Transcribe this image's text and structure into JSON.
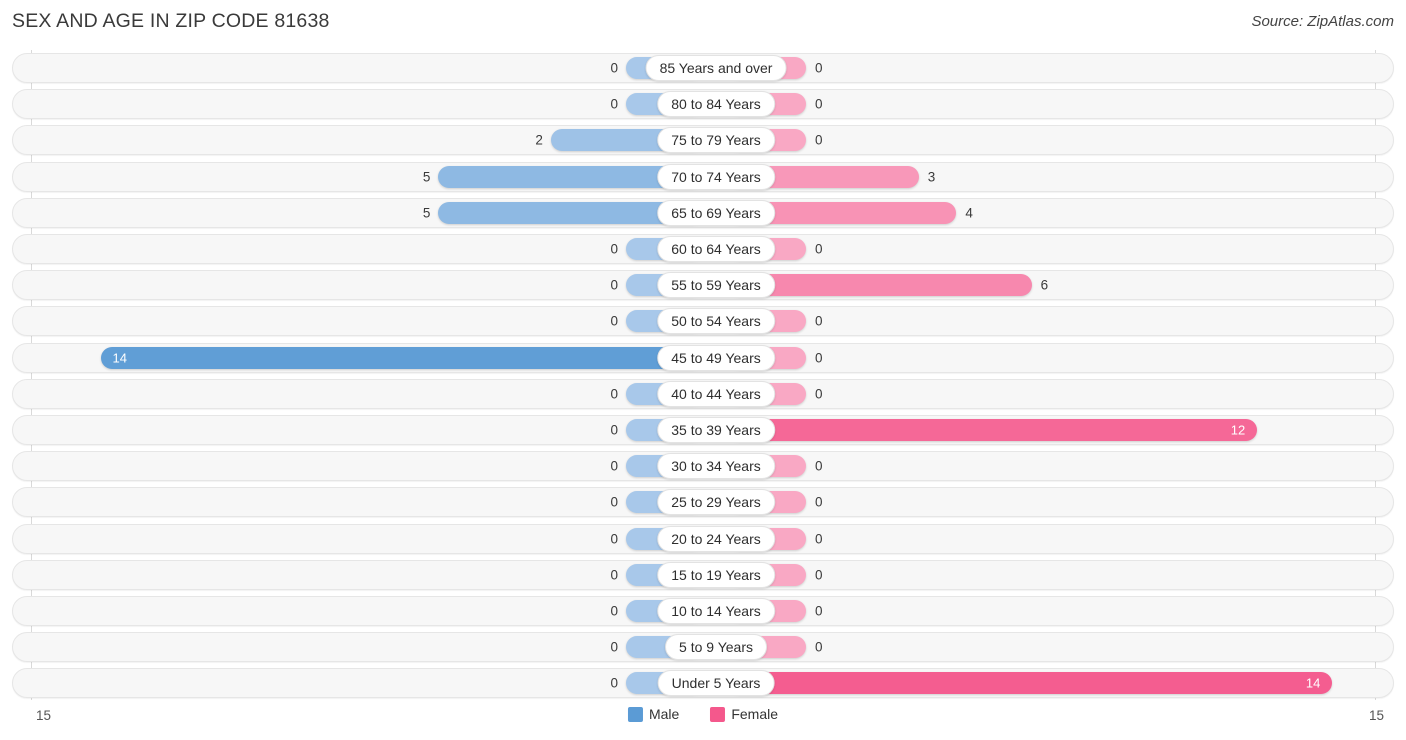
{
  "header": {
    "title": "SEX AND AGE IN ZIP CODE 81638",
    "source": "Source: ZipAtlas.com"
  },
  "legend": {
    "male_label": "Male",
    "female_label": "Female",
    "male_color": "#5b9bd5",
    "female_color": "#f4588c"
  },
  "axis": {
    "left_max": "15",
    "right_max": "15",
    "max_value": 15
  },
  "chart_data": {
    "type": "bar",
    "subtype": "population-pyramid",
    "title": "SEX AND AGE IN ZIP CODE 81638",
    "xlabel": "",
    "ylabel": "",
    "xlim": [
      15,
      15
    ],
    "grid": false,
    "legend_position": "bottom-center",
    "categories": [
      "85 Years and over",
      "80 to 84 Years",
      "75 to 79 Years",
      "70 to 74 Years",
      "65 to 69 Years",
      "60 to 64 Years",
      "55 to 59 Years",
      "50 to 54 Years",
      "45 to 49 Years",
      "40 to 44 Years",
      "35 to 39 Years",
      "30 to 34 Years",
      "25 to 29 Years",
      "20 to 24 Years",
      "15 to 19 Years",
      "10 to 14 Years",
      "5 to 9 Years",
      "Under 5 Years"
    ],
    "series": [
      {
        "name": "Male",
        "color": "#5b9bd5",
        "direction": "left",
        "values": [
          0,
          0,
          2,
          5,
          5,
          0,
          0,
          0,
          14,
          0,
          0,
          0,
          0,
          0,
          0,
          0,
          0,
          0
        ],
        "labels": [
          "0",
          "0",
          "2",
          "5",
          "5",
          "0",
          "0",
          "0",
          "14",
          "0",
          "0",
          "0",
          "0",
          "0",
          "0",
          "0",
          "0",
          "0"
        ]
      },
      {
        "name": "Female",
        "color": "#f4588c",
        "direction": "right",
        "values": [
          0,
          0,
          0,
          3,
          4,
          0,
          6,
          0,
          0,
          0,
          12,
          0,
          0,
          0,
          0,
          0,
          0,
          14
        ],
        "labels": [
          "0",
          "0",
          "0",
          "3",
          "4",
          "0",
          "6",
          "0",
          "0",
          "0",
          "12",
          "0",
          "0",
          "0",
          "0",
          "0",
          "0",
          "14"
        ]
      }
    ]
  }
}
